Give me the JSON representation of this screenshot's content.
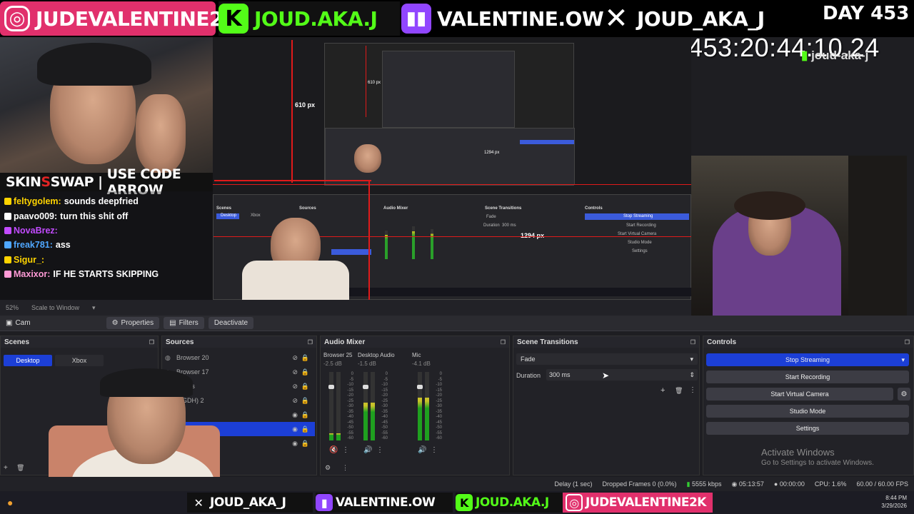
{
  "banner": {
    "instagram": "JUDEVALENTINE2K",
    "kick": "JOUD.AKA.J",
    "twitch": "VALENTINE.OW",
    "x": "JOUD_AKA_J",
    "day": "DAY 453",
    "timer": "453:20:44:10.24",
    "watermark": "joud-aka-j"
  },
  "sponsor": {
    "part1": "SKIN",
    "part2": "SWAP",
    "sep": " | ",
    "code": "USE CODE ARROW"
  },
  "chat": [
    {
      "user": "feltygolem:",
      "text": "sounds deepfried",
      "color": "#ffd400"
    },
    {
      "user": "paavo009:",
      "text": "turn this shit off",
      "color": "#ffffff"
    },
    {
      "user": "NovaBrez:",
      "text": "",
      "color": "#c24bff"
    },
    {
      "user": "freak781:",
      "text": "ass",
      "color": "#4fa7ff"
    },
    {
      "user": "Sigur_:",
      "text": "",
      "color": "#ffd400"
    },
    {
      "user": "Maxixor:",
      "text": "IF HE STARTS SKIPPING",
      "color": "#ff9ad6"
    }
  ],
  "preview": {
    "measure_v": "610 px",
    "measure_v_small": "610 px",
    "measure_h": "1294 px",
    "measure_h_small": "1294 px",
    "inner_docks": {
      "scenes": "Scenes",
      "sources": "Sources",
      "audio": "Audio Mixer",
      "transitions": "Scene Transitions",
      "controls": "Controls",
      "stop_streaming": "Stop Streaming",
      "start_recording": "Start Recording",
      "start_virtual_camera": "Start Virtual Camera",
      "studio_mode": "Studio Mode",
      "settings": "Settings",
      "fade": "Fade",
      "duration": "Duration",
      "duration_value": "300 ms",
      "scene_desktop": "Desktop",
      "scene_xbox": "Xbox"
    }
  },
  "obs": {
    "zoom": "52%",
    "scale": "Scale to Window",
    "source_name": "Cam",
    "properties": "Properties",
    "filters": "Filters",
    "deactivate": "Deactivate",
    "scenes_title": "Scenes",
    "scenes": [
      "Desktop",
      "Xbox"
    ],
    "sources_title": "Sources",
    "sources": [
      "Browser 20",
      "Browser 17",
      "Words",
      "t (GDH) 2",
      "",
      "",
      ""
    ],
    "audio_title": "Audio Mixer",
    "channels": [
      {
        "name": "Browser 25",
        "db": "-2.5 dB",
        "level": 0.1
      },
      {
        "name": "Desktop Audio",
        "db": "-1.5 dB",
        "level": 0.55
      },
      {
        "name": "Mic",
        "db": "-4.1 dB",
        "level": 0.62
      }
    ],
    "meter_ticks": [
      "0",
      "-5",
      "-10",
      "-15",
      "-20",
      "-25",
      "-30",
      "-35",
      "-40",
      "-45",
      "-50",
      "-55",
      "-60"
    ],
    "transitions_title": "Scene Transitions",
    "transition": "Fade",
    "duration_label": "Duration",
    "duration_value": "300 ms",
    "controls_title": "Controls",
    "stop_streaming": "Stop Streaming",
    "start_recording": "Start Recording",
    "start_virtual_camera": "Start Virtual Camera",
    "studio_mode": "Studio Mode",
    "settings": "Settings",
    "activate_title": "Activate Windows",
    "activate_sub": "Go to Settings to activate Windows."
  },
  "status": {
    "delay": "Delay (1 sec)",
    "dropped": "Dropped Frames 0 (0.0%)",
    "bitrate": "5555 kbps",
    "stream_time": "05:13:57",
    "rec_time": "00:00:00",
    "cpu": "CPU: 1.6%",
    "fps": "60.00 / 60.00 FPS"
  },
  "tray": {
    "time": "8:44 PM",
    "date": "3/29/2026"
  },
  "bottom": {
    "x": "JOUD_AKA_J",
    "twitch": "VALENTINE.OW",
    "kick": "JOUD.AKA.J",
    "instagram": "JUDEVALENTINE2K"
  },
  "colors": {
    "accent_blue": "#1c3fd6",
    "kick_green": "#53fc18",
    "twitch_purple": "#9146ff",
    "instagram_pink": "#e1306c",
    "measure_red": "#e01a1a"
  }
}
